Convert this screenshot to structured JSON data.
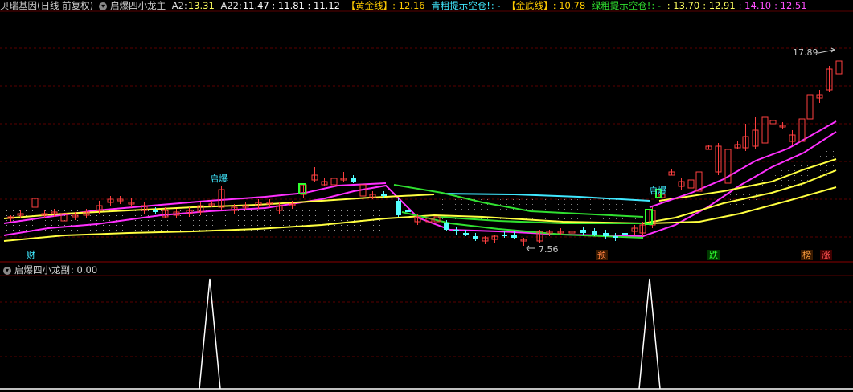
{
  "main_header": {
    "title": "贝瑞基因(日线 前复权)",
    "indicator": "启爆四小龙主",
    "a2_label": "A2:",
    "a2_value": "13.31",
    "a22_label": "A22:",
    "a22_values": "11.47 : 11.81 : 11.12",
    "gold_line_label": "【黄金线】",
    "gold_line_value": ": 12.16",
    "cyan_hint": "青粗提示空仓!",
    "cyan_hint_value": ": -",
    "bottom_line_label": "【金底线】",
    "bottom_line_value": ": 10.78",
    "green_hint": "绿粗提示空仓!",
    "green_hint_value": ": -",
    "v1": ": 13.70",
    "v2": ": 12.91",
    "v3": ": 14.10",
    "v4": ": 12.51"
  },
  "sub_header": {
    "indicator": "启爆四小龙副",
    "value": ": 0.00"
  },
  "annotations": {
    "high_price": "17.89",
    "low_price": "7.56",
    "qibao_1": "启爆",
    "qibao_2": "启爆"
  },
  "markers": {
    "cai": "财",
    "yu": "预",
    "die": "跌",
    "bang": "榜",
    "zhang": "涨"
  },
  "colors": {
    "background": "#000000",
    "grid": "#5a0000",
    "up_candle": "#ff4040",
    "down_candle": "#54ffff",
    "magenta_line": "#ff30ff",
    "yellow_line": "#ffff40",
    "cyan_line": "#40e8ff",
    "green_line": "#30e030",
    "gold_text": "#ffcc00"
  }
}
